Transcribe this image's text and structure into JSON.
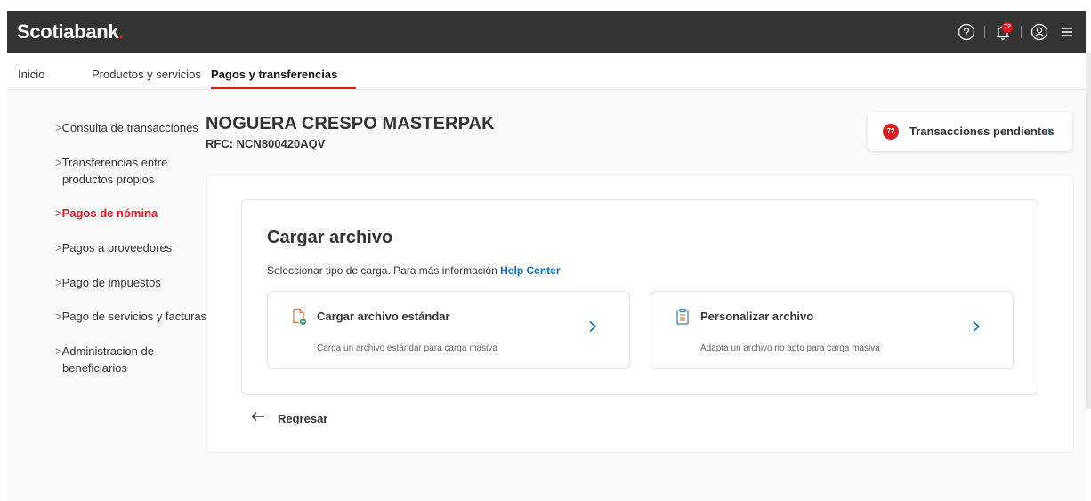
{
  "header": {
    "logo_text": "Scotiabank",
    "logo_dot": ".",
    "notification_count": "72"
  },
  "nav": {
    "items": [
      {
        "label": "Inicio"
      },
      {
        "label": "Productos y servicios"
      },
      {
        "label": "Pagos y transferencias"
      }
    ]
  },
  "sidebar": {
    "items": [
      {
        "chevron": ">",
        "label": "Consulta de transacciones"
      },
      {
        "chevron": ">",
        "label": "Transferencias entre",
        "label2": "productos propios"
      },
      {
        "chevron": ">",
        "label": "Pagos de nómina"
      },
      {
        "chevron": ">",
        "label": "Pagos a proveedores"
      },
      {
        "chevron": ">",
        "label": "Pago de impuestos"
      },
      {
        "chevron": ">",
        "label": "Pago de servicios y facturas"
      },
      {
        "chevron": ">",
        "label": "Administracion de",
        "label2": "beneficiarios"
      }
    ]
  },
  "company": {
    "name": "NOGUERA CRESPO MASTERPAK",
    "rfc": "RFC: NCN800420AQV"
  },
  "pending": {
    "count": "72",
    "label": "Transacciones pendientes"
  },
  "upload": {
    "title": "Cargar archivo",
    "subtitle": "Seleccionar tipo de carga. Para más información",
    "help_link": "Help Center",
    "options": [
      {
        "title": "Cargar archivo estándar",
        "description": "Carga un archivo estándar para carga masiva",
        "icon": "file-upload-icon"
      },
      {
        "title": "Personalizar archivo",
        "description": "Adapta un archivo no apto para carga masiva",
        "icon": "clipboard-list-icon"
      }
    ]
  },
  "back": {
    "label": "Regresar"
  },
  "colors": {
    "brand_red": "#ec111a",
    "link_blue": "#0a6cbe",
    "header_dark": "#333333"
  }
}
